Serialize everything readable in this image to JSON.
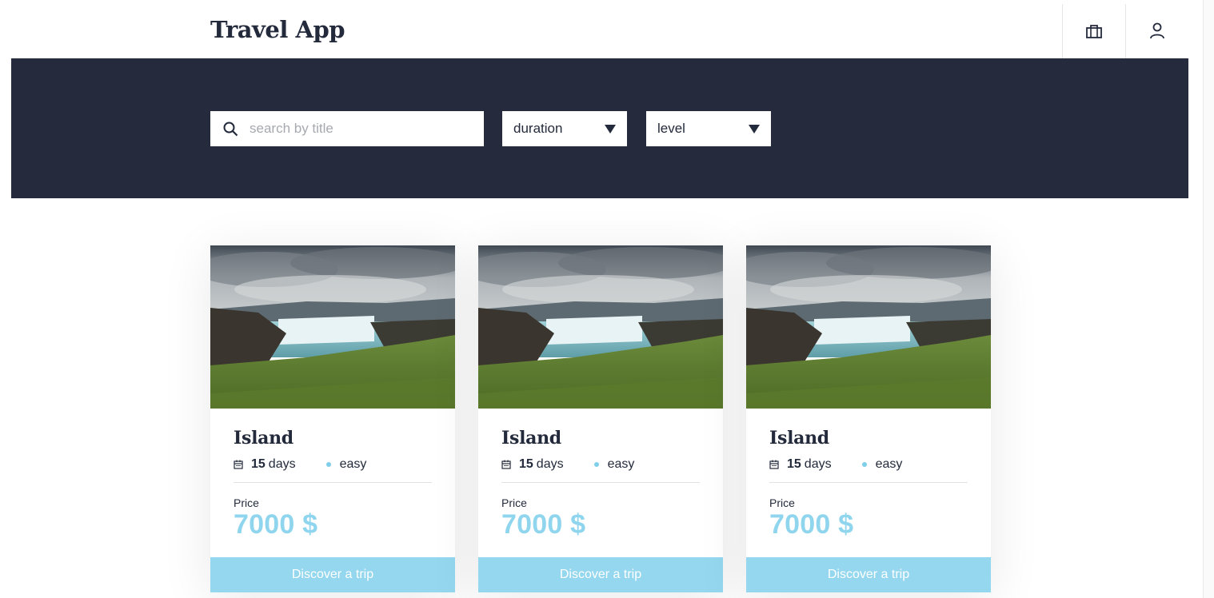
{
  "header": {
    "logo": "Travel App",
    "nav": [
      {
        "icon": "briefcase-icon"
      },
      {
        "icon": "user-icon"
      }
    ]
  },
  "filters": {
    "search_placeholder": "search by title",
    "duration_label": "duration",
    "level_label": "level"
  },
  "trips": [
    {
      "title": "Island",
      "duration_value": "15",
      "duration_unit": "days",
      "level": "easy",
      "price_label": "Price",
      "price": "7000 $",
      "button_label": "Discover a trip"
    },
    {
      "title": "Island",
      "duration_value": "15",
      "duration_unit": "days",
      "level": "easy",
      "price_label": "Price",
      "price": "7000 $",
      "button_label": "Discover a trip"
    },
    {
      "title": "Island",
      "duration_value": "15",
      "duration_unit": "days",
      "level": "easy",
      "price_label": "Price",
      "price": "7000 $",
      "button_label": "Discover a trip"
    }
  ],
  "colors": {
    "dark": "#252b3c",
    "accent": "#94d7ee",
    "price": "#8fd5ee"
  }
}
